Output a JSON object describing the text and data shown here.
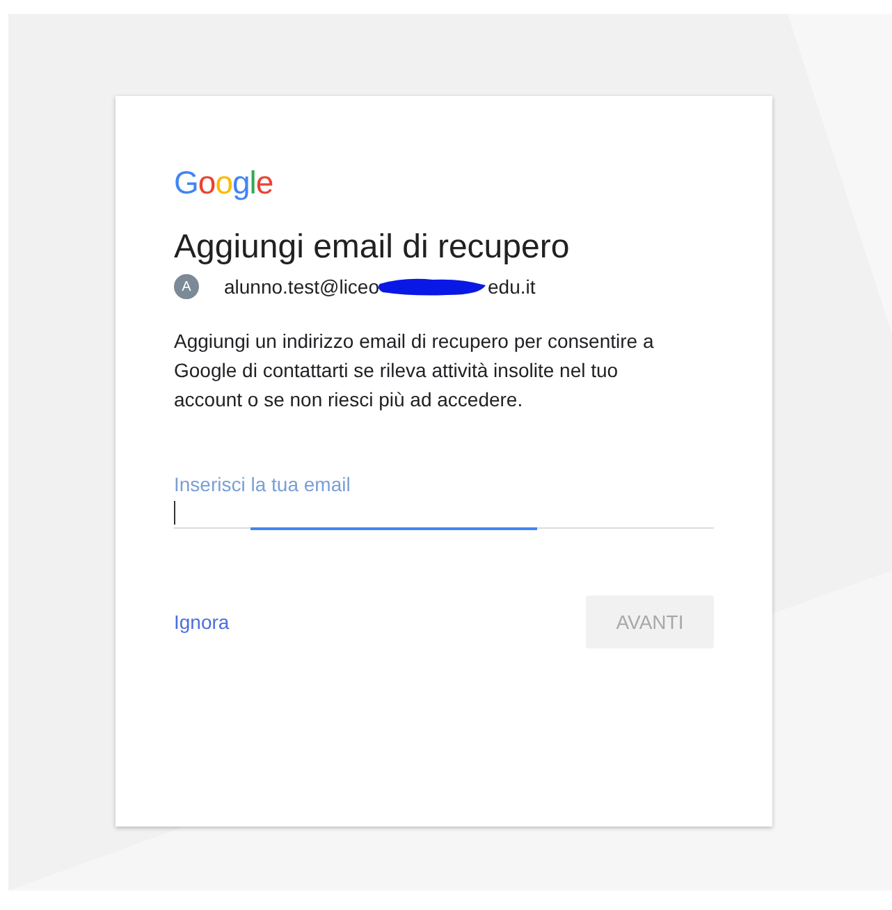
{
  "logo": "Google",
  "title": "Aggiungi email di recupero",
  "account": {
    "avatar": "A",
    "email_start": "alunno.test@liceo",
    "email_end": "edu.it",
    "redacted": true
  },
  "description": "Aggiungi un indirizzo email di recupero per consentire a Google di contattarti se rileva attività insolite nel tuo account o se non riesci più ad accedere.",
  "email_field": {
    "placeholder": "Inserisci la tua email",
    "focused": true
  },
  "skip_link": "Ignora",
  "next_button": {
    "label": "AVANTI",
    "disabled": true
  }
}
